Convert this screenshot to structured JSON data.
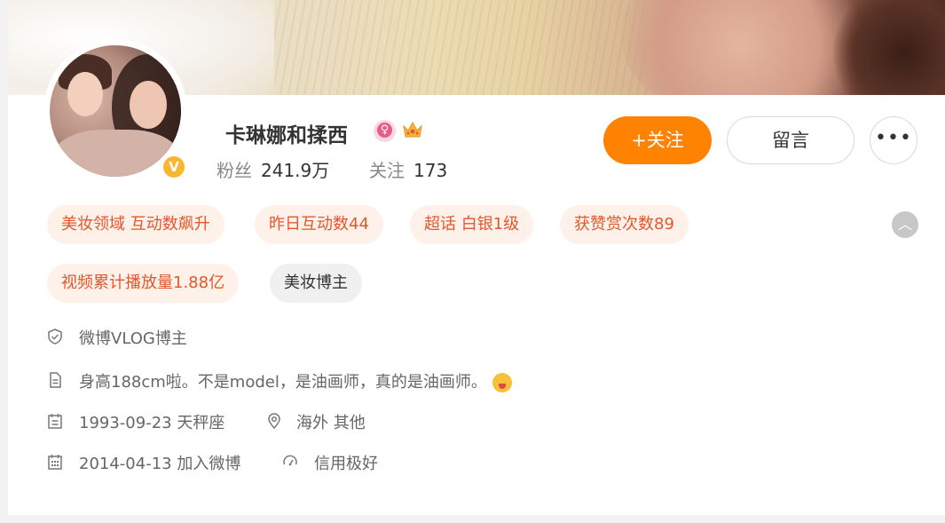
{
  "profile": {
    "name": "卡琳娜和揉西",
    "verify_badge": "V",
    "gender_symbol": "♀",
    "followers_label": "粉丝",
    "followers_value": "241.9万",
    "following_label": "关注",
    "following_value": "173"
  },
  "actions": {
    "follow_label": "+关注",
    "message_label": "留言",
    "more_label": "•••"
  },
  "tags": [
    "美妆领域 互动数飙升",
    "昨日互动数44",
    "超话 白银1级",
    "获赞赏次数89",
    "视频累计播放量1.88亿",
    "美妆博主"
  ],
  "collapse_symbol": "︿",
  "info": {
    "verification": "微博VLOG博主",
    "bio": "身高188cm啦。不是model，是油画师，真的是油画师。",
    "birthday": "1993-09-23 天秤座",
    "location": "海外 其他",
    "joined": "2014-04-13 加入微博",
    "credit": "信用极好"
  },
  "icons": {
    "verification": "shield-check-icon",
    "bio": "document-icon",
    "birthday": "calendar-icon",
    "location": "location-pin-icon",
    "joined": "calendar-grid-icon",
    "credit": "credit-icon",
    "emoji": "tongue-wink-emoji-icon",
    "crown": "crown-icon"
  },
  "colors": {
    "accent": "#ff8200",
    "tag_bg": "#fdf1ea",
    "tag_text": "#e2582c",
    "verify_gold": "#f7b731",
    "gender_pink": "#ea5b8c"
  }
}
